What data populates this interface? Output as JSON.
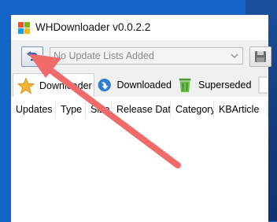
{
  "window": {
    "title": "WHDownloader v0.0.2.2"
  },
  "toolbar": {
    "refresh_icon": "undo-refresh-icon",
    "select": {
      "value": "No Update Lists Added"
    },
    "save_icon": "floppy-disk-icon"
  },
  "tabs": [
    {
      "label": "Downloader",
      "icon": "star-icon"
    },
    {
      "label": "Downloaded",
      "icon": "blue-arrow-icon"
    },
    {
      "label": "Superseded",
      "icon": "trash-can-icon"
    }
  ],
  "table": {
    "columns": [
      "Updates",
      "Type",
      "Size",
      "Release Date",
      "Category",
      "KBArticle"
    ]
  },
  "colors": {
    "desktop": "#1565c8",
    "annotation_arrow": "#f26b6b"
  }
}
